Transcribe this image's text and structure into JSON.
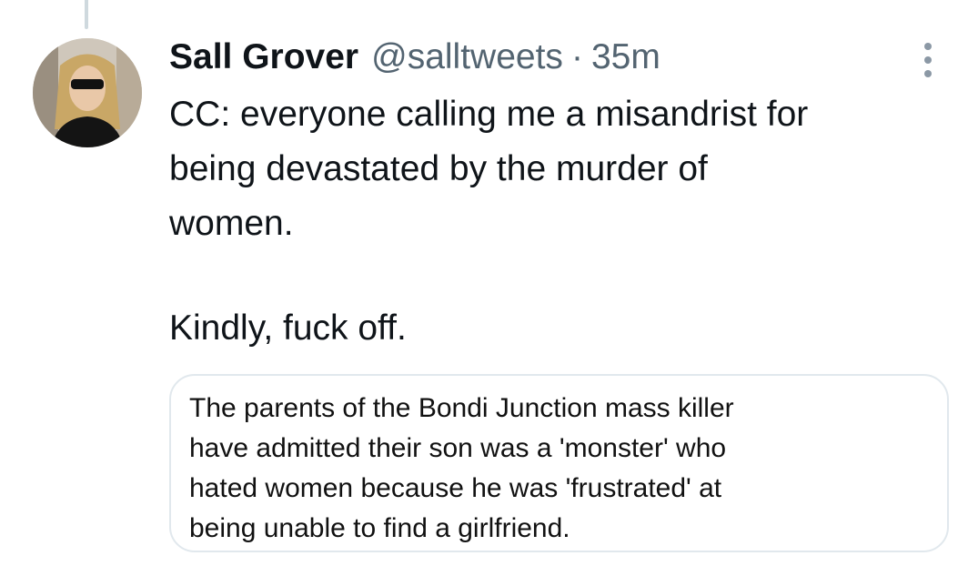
{
  "tweet": {
    "author": {
      "name": "Sall Grover",
      "handle": "@salltweets",
      "separator": "·",
      "time": "35m"
    },
    "text_lines": [
      "CC: everyone calling me a misandrist for",
      "being devastated by the murder of",
      "women."
    ],
    "text_line_2": "Kindly, fuck off.",
    "quoted_image_text_lines": [
      "The parents of the Bondi Junction mass killer",
      "have admitted their son was a 'monster' who",
      "hated women because he was 'frustrated' at",
      "being unable to find a girlfriend."
    ]
  },
  "icons": {
    "more": "more-vertical-icon",
    "avatar": "profile-photo"
  },
  "colors": {
    "text_primary": "#0f1419",
    "text_secondary": "#536471",
    "border": "#e1e8ed",
    "thread_line": "#cfd9de"
  }
}
